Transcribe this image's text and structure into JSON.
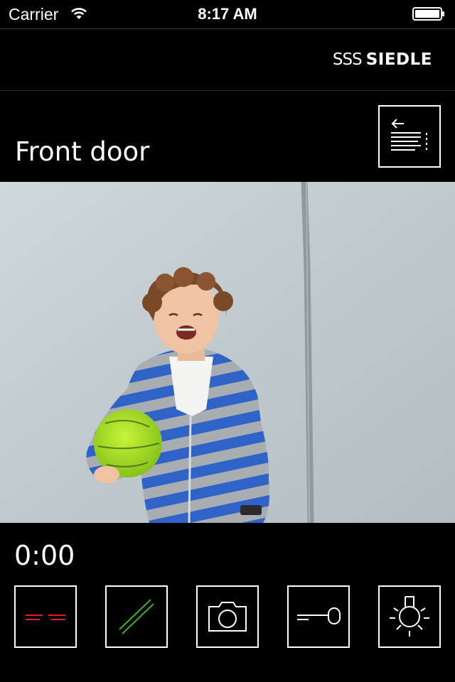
{
  "status_bar": {
    "carrier": "Carrier",
    "time": "8:17 AM",
    "wifi_icon": "wifi-icon",
    "battery_icon": "battery-icon"
  },
  "header": {
    "brand_mark": "SSS",
    "brand_name": "SIEDLE"
  },
  "door": {
    "title": "Front door",
    "menu_icon": "back-list-icon"
  },
  "video": {
    "description_icon": "camera-feed"
  },
  "call": {
    "timer": "0:00"
  },
  "controls": [
    {
      "name": "hang-up",
      "icon": "hang-up-icon",
      "color": "#e0201a"
    },
    {
      "name": "answer",
      "icon": "answer-icon",
      "color": "#3cb028"
    },
    {
      "name": "snapshot",
      "icon": "camera-icon",
      "color": "#ffffff"
    },
    {
      "name": "door-opener",
      "icon": "key-icon",
      "color": "#ffffff"
    },
    {
      "name": "light",
      "icon": "light-bulb-icon",
      "color": "#ffffff"
    }
  ],
  "colors": {
    "background": "#000000",
    "hang_up": "#e0201a",
    "answer": "#3cb028"
  }
}
